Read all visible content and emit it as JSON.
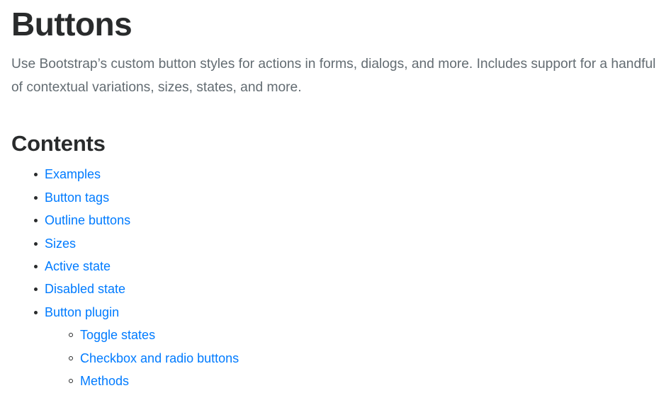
{
  "page": {
    "title": "Buttons",
    "lead": "Use Bootstrap’s custom button styles for actions in forms, dialogs, and more. Includes support for a handful of contextual variations, sizes, states, and more.",
    "contents_heading": "Contents",
    "link_color": "#007bff",
    "text_color": "#292b2c",
    "lead_color": "#636c72"
  },
  "toc": {
    "items": [
      {
        "label": "Examples"
      },
      {
        "label": "Button tags"
      },
      {
        "label": "Outline buttons"
      },
      {
        "label": "Sizes"
      },
      {
        "label": "Active state"
      },
      {
        "label": "Disabled state"
      },
      {
        "label": "Button plugin",
        "children": [
          {
            "label": "Toggle states"
          },
          {
            "label": "Checkbox and radio buttons"
          },
          {
            "label": "Methods"
          }
        ]
      }
    ]
  }
}
